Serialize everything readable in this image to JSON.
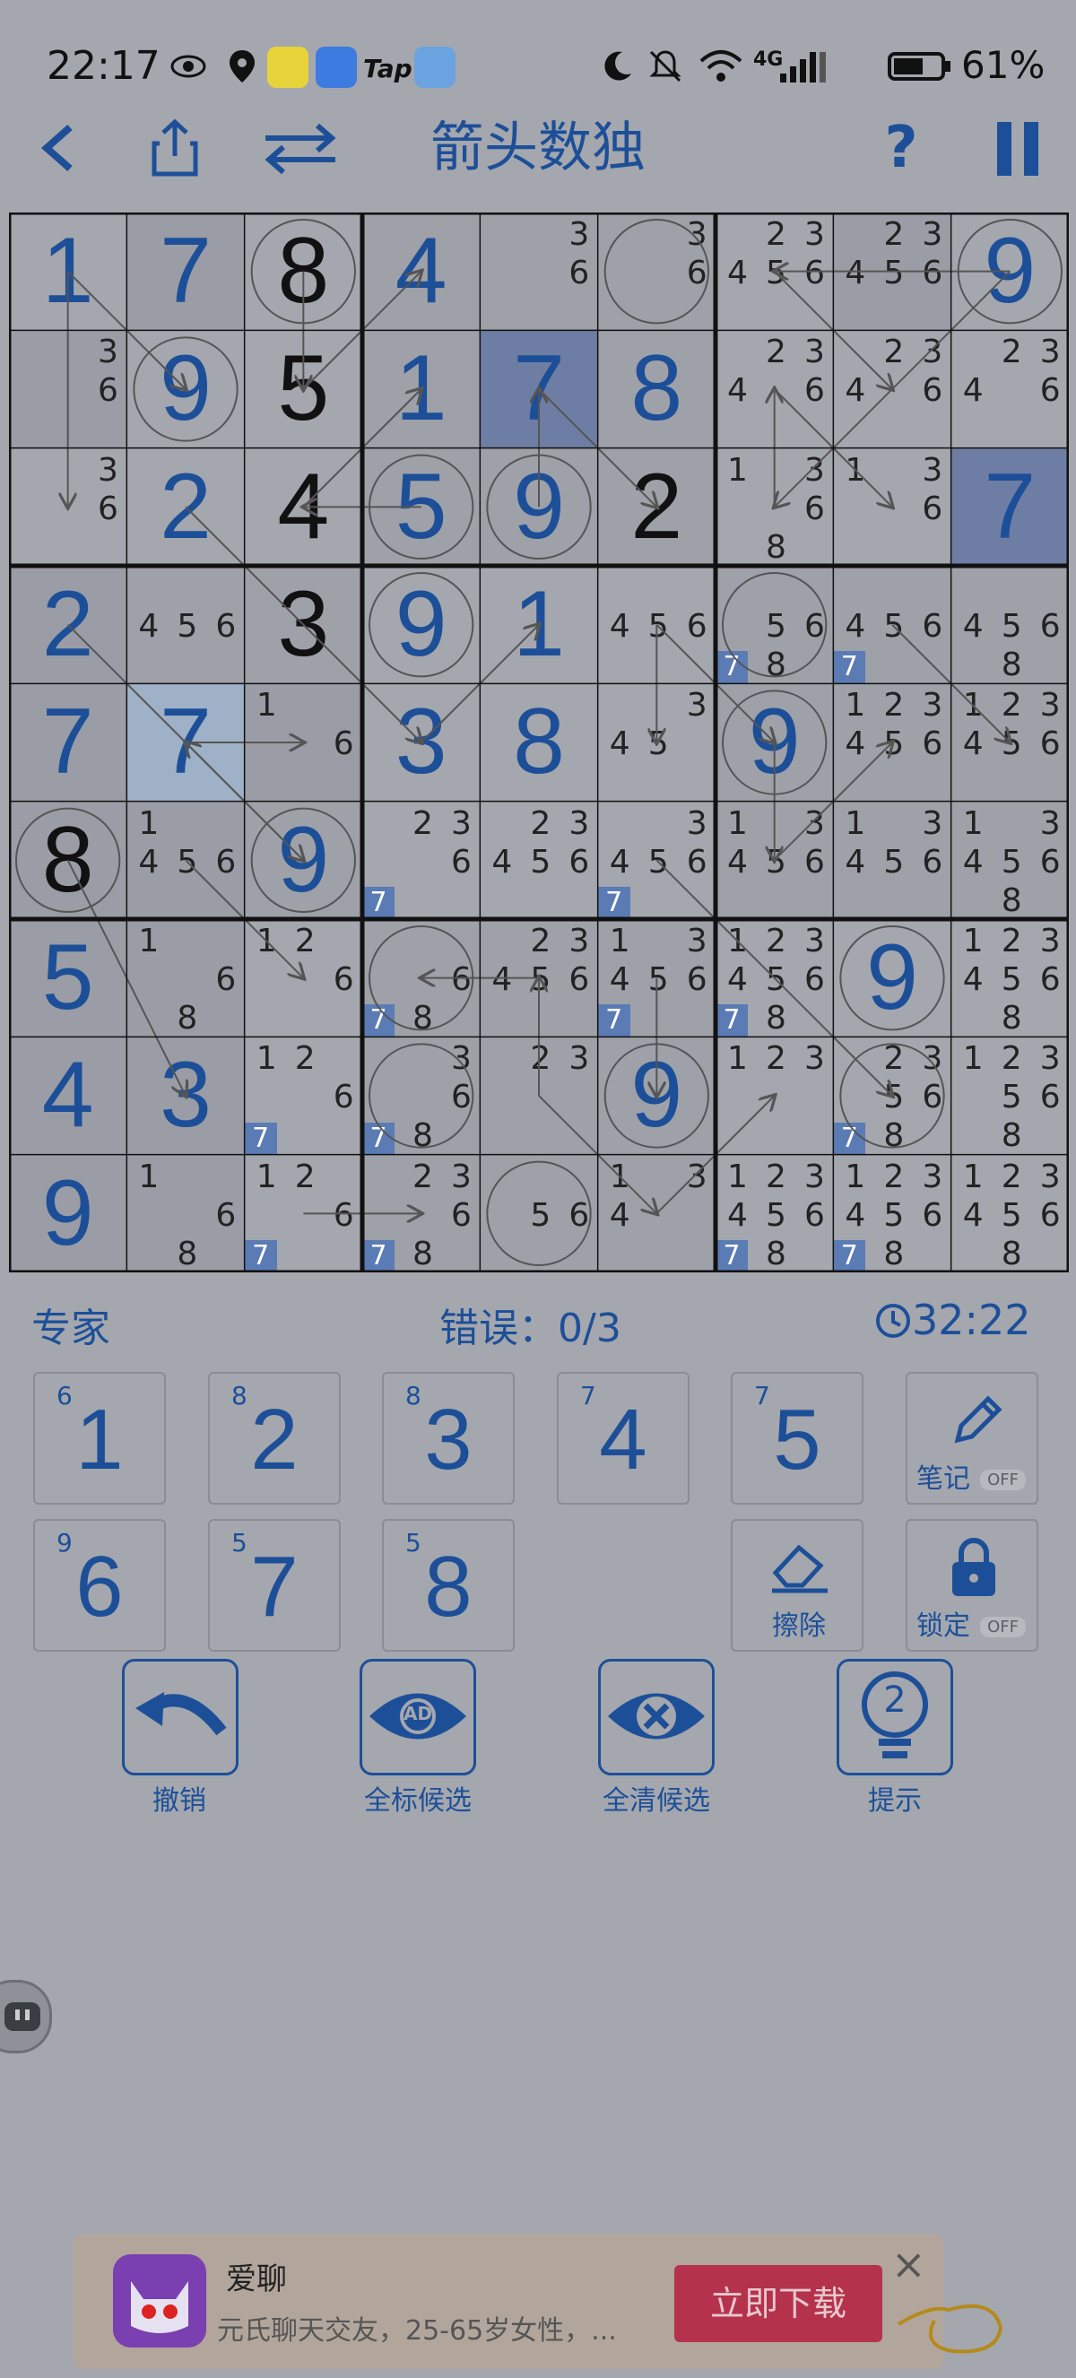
{
  "status_bar": {
    "time": "22:17",
    "tap_label": "Tap",
    "battery_pct": "61%",
    "signal": "4G",
    "icons": [
      "eye-icon",
      "location-icon",
      "qq-music-icon",
      "messages-icon",
      "tap-icon",
      "weather-icon",
      "moon-icon",
      "mute-icon",
      "wifi-icon",
      "signal-icon",
      "battery-icon"
    ]
  },
  "header": {
    "title": "箭头数独",
    "back": "<",
    "help": "?",
    "icons": [
      "back-icon",
      "share-icon",
      "swap-icon",
      "help-icon",
      "pause-icon"
    ]
  },
  "board": {
    "cells": [
      [
        {
          "v": "1"
        },
        {
          "v": "7"
        },
        {
          "v": "8",
          "given": true,
          "circle": true
        },
        {
          "v": "4"
        },
        {
          "c": [
            "3",
            "6"
          ]
        },
        {
          "c": [
            "3",
            "6"
          ],
          "circle": true
        },
        {
          "c": [
            "2",
            "3",
            "4",
            "5",
            "6"
          ]
        },
        {
          "c": [
            "2",
            "3",
            "4",
            "5",
            "6"
          ]
        },
        {
          "v": "9",
          "circle": true
        }
      ],
      [
        {
          "c": [
            "3",
            "6"
          ]
        },
        {
          "v": "9",
          "circle": true
        },
        {
          "v": "5",
          "given": true
        },
        {
          "v": "1"
        },
        {
          "v": "7"
        },
        {
          "v": "8"
        },
        {
          "c": [
            "2",
            "3",
            "4",
            "6"
          ]
        },
        {
          "c": [
            "2",
            "3",
            "4",
            "6"
          ]
        },
        {
          "c": [
            "2",
            "3",
            "4",
            "6"
          ]
        }
      ],
      [
        {
          "c": [
            "3",
            "6"
          ]
        },
        {
          "v": "2"
        },
        {
          "v": "4",
          "given": true
        },
        {
          "v": "5",
          "circle": true
        },
        {
          "v": "9",
          "circle": true
        },
        {
          "v": "2",
          "given": true
        },
        {
          "c": [
            "1",
            "3",
            "6",
            "8"
          ]
        },
        {
          "c": [
            "1",
            "3",
            "6"
          ]
        },
        {
          "v": "7"
        }
      ],
      [
        {
          "v": "2"
        },
        {
          "c": [
            "4",
            "5",
            "6"
          ]
        },
        {
          "v": "3",
          "given": true
        },
        {
          "v": "9",
          "circle": true
        },
        {
          "v": "1"
        },
        {
          "c": [
            "4",
            "5",
            "6"
          ]
        },
        {
          "c": [
            "5",
            "6",
            "8"
          ],
          "corner": "7",
          "circle": true
        },
        {
          "c": [
            "4",
            "5",
            "6"
          ],
          "corner": "7"
        },
        {
          "c": [
            "4",
            "5",
            "6",
            "8"
          ]
        }
      ],
      [
        {
          "v": "7"
        },
        {
          "v": "7"
        },
        {
          "c": [
            "1",
            "6"
          ]
        },
        {
          "v": "3"
        },
        {
          "v": "8"
        },
        {
          "c": [
            "3",
            "4",
            "5"
          ]
        },
        {
          "v": "9",
          "circle": true
        },
        {
          "c": [
            "1",
            "2",
            "3",
            "4",
            "5",
            "6"
          ]
        },
        {
          "c": [
            "1",
            "2",
            "3",
            "4",
            "5",
            "6"
          ]
        }
      ],
      [
        {
          "v": "8",
          "given": true,
          "circle": true
        },
        {
          "c": [
            "1",
            "4",
            "5",
            "6"
          ]
        },
        {
          "v": "9",
          "circle": true
        },
        {
          "c": [
            "2",
            "3",
            "6"
          ],
          "corner": "7"
        },
        {
          "c": [
            "2",
            "3",
            "4",
            "5",
            "6"
          ]
        },
        {
          "c": [
            "3",
            "4",
            "5",
            "6"
          ],
          "corner": "7"
        },
        {
          "c": [
            "1",
            "3",
            "4",
            "5",
            "6"
          ]
        },
        {
          "c": [
            "1",
            "3",
            "4",
            "5",
            "6"
          ]
        },
        {
          "c": [
            "1",
            "3",
            "4",
            "5",
            "6",
            "8"
          ]
        }
      ],
      [
        {
          "v": "5"
        },
        {
          "c": [
            "1",
            "6",
            "8"
          ]
        },
        {
          "c": [
            "1",
            "2",
            "6"
          ]
        },
        {
          "c": [
            "6",
            "8"
          ],
          "corner": "7",
          "circle": true
        },
        {
          "c": [
            "2",
            "3",
            "4",
            "5",
            "6"
          ]
        },
        {
          "c": [
            "1",
            "3",
            "4",
            "5",
            "6"
          ],
          "corner": "7"
        },
        {
          "c": [
            "1",
            "2",
            "3",
            "4",
            "5",
            "6",
            "8"
          ],
          "corner": "7"
        },
        {
          "v": "9",
          "circle": true
        },
        {
          "c": [
            "1",
            "2",
            "3",
            "4",
            "5",
            "6",
            "8"
          ]
        }
      ],
      [
        {
          "v": "4"
        },
        {
          "v": "3"
        },
        {
          "c": [
            "1",
            "2",
            "6"
          ],
          "corner": "7"
        },
        {
          "c": [
            "3",
            "6",
            "8"
          ],
          "corner": "7",
          "circle": true
        },
        {
          "c": [
            "2",
            "3"
          ]
        },
        {
          "v": "9",
          "circle": true
        },
        {
          "c": [
            "1",
            "2",
            "3"
          ]
        },
        {
          "c": [
            "2",
            "3",
            "5",
            "6",
            "8"
          ],
          "corner": "7",
          "circle": true
        },
        {
          "c": [
            "1",
            "2",
            "3",
            "5",
            "6",
            "8"
          ]
        }
      ],
      [
        {
          "v": "9"
        },
        {
          "c": [
            "1",
            "6",
            "8"
          ]
        },
        {
          "c": [
            "1",
            "2",
            "6"
          ],
          "corner": "7"
        },
        {
          "c": [
            "2",
            "3",
            "6",
            "8"
          ],
          "corner": "7"
        },
        {
          "c": [
            "5",
            "6"
          ],
          "circle": true
        },
        {
          "c": [
            "1",
            "3",
            "4"
          ]
        },
        {
          "c": [
            "1",
            "2",
            "3",
            "4",
            "5",
            "6",
            "8"
          ],
          "corner": "7"
        },
        {
          "c": [
            "1",
            "2",
            "3",
            "4",
            "5",
            "6",
            "8"
          ],
          "corner": "7"
        },
        {
          "c": [
            "1",
            "2",
            "3",
            "4",
            "5",
            "6",
            "8"
          ]
        }
      ]
    ],
    "arrows": [
      {
        "from": [
          0,
          0
        ],
        "to": [
          1,
          1
        ]
      },
      {
        "from": [
          0,
          0
        ],
        "to": [
          2,
          0
        ]
      },
      {
        "from": [
          0,
          2
        ],
        "to": [
          1,
          2
        ]
      },
      {
        "from": [
          1,
          2
        ],
        "to": [
          0,
          3
        ]
      },
      {
        "from": [
          0,
          8
        ],
        "to": [
          0,
          6
        ]
      },
      {
        "from": [
          0,
          6
        ],
        "to": [
          1,
          7
        ]
      },
      {
        "from": [
          0,
          8
        ],
        "to": [
          2,
          6
        ]
      },
      {
        "from": [
          2,
          6
        ],
        "to": [
          1,
          6
        ]
      },
      {
        "from": [
          1,
          6
        ],
        "to": [
          2,
          7
        ]
      },
      {
        "from": [
          2,
          2
        ],
        "to": [
          1,
          3
        ]
      },
      {
        "from": [
          2,
          4
        ],
        "to": [
          1,
          4
        ]
      },
      {
        "from": [
          1,
          4
        ],
        "to": [
          2,
          5
        ]
      },
      {
        "from": [
          2,
          3
        ],
        "to": [
          2,
          2
        ]
      },
      {
        "from": [
          2,
          1
        ],
        "to": [
          4,
          3
        ]
      },
      {
        "from": [
          4,
          3
        ],
        "to": [
          3,
          4
        ]
      },
      {
        "from": [
          3,
          0
        ],
        "to": [
          5,
          2
        ]
      },
      {
        "from": [
          5,
          2
        ],
        "to": [
          4,
          1
        ]
      },
      {
        "from": [
          4,
          1
        ],
        "to": [
          4,
          2
        ]
      },
      {
        "from": [
          3,
          5
        ],
        "to": [
          4,
          5
        ]
      },
      {
        "from": [
          3,
          5
        ],
        "to": [
          4,
          6
        ]
      },
      {
        "from": [
          3,
          7
        ],
        "to": [
          4,
          8
        ]
      },
      {
        "from": [
          4,
          6
        ],
        "to": [
          5,
          6
        ]
      },
      {
        "from": [
          5,
          6
        ],
        "to": [
          4,
          7
        ]
      },
      {
        "from": [
          5,
          5
        ],
        "to": [
          7,
          7
        ]
      },
      {
        "from": [
          5,
          0
        ],
        "to": [
          7,
          1
        ]
      },
      {
        "from": [
          5,
          1
        ],
        "to": [
          6,
          2
        ]
      },
      {
        "from": [
          6,
          4
        ],
        "to": [
          6,
          3
        ]
      },
      {
        "from": [
          6,
          5
        ],
        "to": [
          7,
          5
        ]
      },
      {
        "from": [
          7,
          4
        ],
        "to": [
          8,
          5
        ]
      },
      {
        "from": [
          8,
          5
        ],
        "to": [
          7,
          6
        ]
      },
      {
        "from": [
          8,
          2
        ],
        "to": [
          8,
          3
        ]
      },
      {
        "from": [
          7,
          4
        ],
        "to": [
          6,
          4
        ]
      }
    ]
  },
  "info": {
    "difficulty": "专家",
    "errors": "错误：0/3",
    "timer": "32:22"
  },
  "numpad": [
    {
      "num": "1",
      "count": "6"
    },
    {
      "num": "2",
      "count": "8"
    },
    {
      "num": "3",
      "count": "8"
    },
    {
      "num": "4",
      "count": "7"
    },
    {
      "num": "5",
      "count": "7"
    },
    {
      "num": "6",
      "count": "9"
    },
    {
      "num": "7",
      "count": "5"
    },
    {
      "num": "8",
      "count": "5"
    }
  ],
  "tools": {
    "note_label": "笔记",
    "note_state": "OFF",
    "erase_label": "擦除",
    "lock_label": "锁定",
    "lock_state": "OFF"
  },
  "actions": {
    "undo": "撤销",
    "mark_all": "全标候选",
    "ad_badge": "AD",
    "clear_all": "全清候选",
    "hint": "提示",
    "hint_count": "2"
  },
  "ad": {
    "app_name": "爱聊",
    "description": "元氏聊天交友，25-65岁女性，...",
    "download": "立即下载",
    "close": "×"
  },
  "colors": {
    "background": "#a4a7ad",
    "accent": "#1d4f99",
    "ad_button": "#b5324c"
  }
}
